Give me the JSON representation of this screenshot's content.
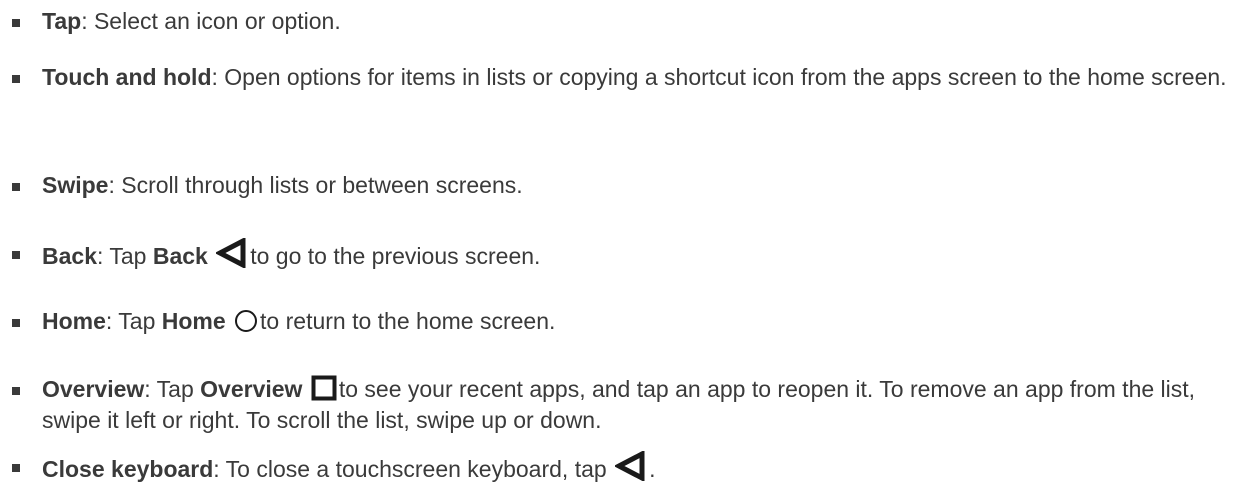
{
  "items": [
    {
      "term": "Tap",
      "text": ": Select an icon or option."
    },
    {
      "term": "Touch and hold",
      "text": ": Open options for items in lists or copying a shortcut icon from the apps screen to the home screen."
    },
    {
      "term": "Swipe",
      "text": ": Scroll through lists or between screens."
    },
    {
      "term": "Back",
      "text_before": ": Tap ",
      "button": "Back",
      "icon": "back-triangle-icon",
      "text_after": "to go to the previous screen."
    },
    {
      "term": "Home",
      "text_before": ": Tap ",
      "button": "Home",
      "icon": "home-circle-icon",
      "text_after": "to return to the home screen."
    },
    {
      "term": "Overview",
      "text_before": ": Tap ",
      "button": "Overview",
      "icon": "overview-square-icon",
      "text_after": "to see your recent apps, and tap an app to reopen it. To remove an app from the list, swipe it left or right. To scroll the list, swipe up or down."
    },
    {
      "term": "Close keyboard",
      "text_before": ": To close a touchscreen keyboard, tap ",
      "icon": "back-triangle-icon",
      "text_after": "."
    }
  ]
}
